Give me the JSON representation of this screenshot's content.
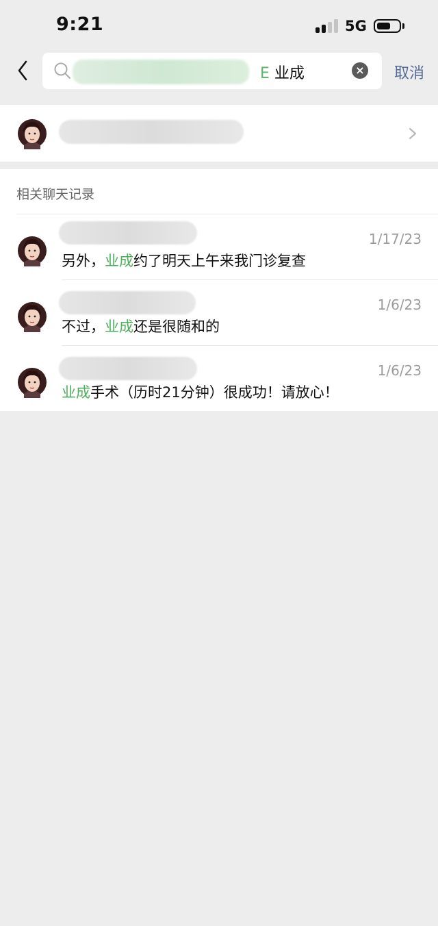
{
  "status": {
    "time": "9:21",
    "network": "5G"
  },
  "search": {
    "query_visible_fragment": "E",
    "query_keyword": "业成",
    "cancel_label": "取消",
    "clear_icon": "×"
  },
  "history": {
    "section_title": "相关聊天记录",
    "keyword": "业成",
    "items": [
      {
        "date": "1/17/23",
        "before": "另外，",
        "highlight": "业成",
        "after": "约了明天上午来我门诊复查"
      },
      {
        "date": "1/6/23",
        "before": "不过，",
        "highlight": "业成",
        "after": "还是很随和的"
      },
      {
        "date": "1/6/23",
        "before": "",
        "highlight": "业成",
        "after": "手术（历时21分钟）很成功！请放心！"
      }
    ]
  },
  "colors": {
    "background": "#ededed",
    "highlight": "#4caf5c",
    "link": "#576b95"
  }
}
